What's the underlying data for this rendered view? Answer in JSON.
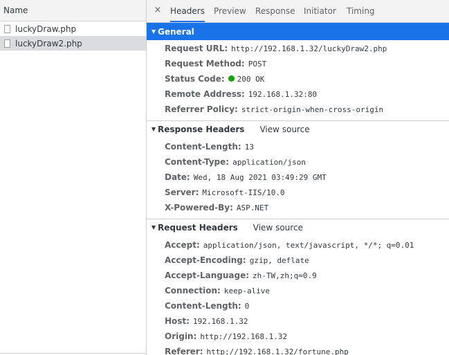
{
  "request_list": {
    "header": "Name",
    "items": [
      {
        "name": "luckyDraw.php",
        "selected": false
      },
      {
        "name": "luckyDraw2.php",
        "selected": true
      }
    ]
  },
  "tabs": {
    "close_glyph": "×",
    "items": [
      "Headers",
      "Preview",
      "Response",
      "Initiator",
      "Timing"
    ],
    "active": "Headers"
  },
  "general": {
    "title": "General",
    "rows": [
      {
        "name": "Request URL:",
        "value": "http://192.168.1.32/luckyDraw2.php"
      },
      {
        "name": "Request Method:",
        "value": "POST"
      },
      {
        "name": "Status Code:",
        "value": "200 OK",
        "status_color": "#0ca40c"
      },
      {
        "name": "Remote Address:",
        "value": "192.168.1.32:80"
      },
      {
        "name": "Referrer Policy:",
        "value": "strict-origin-when-cross-origin"
      }
    ]
  },
  "response_headers": {
    "title": "Response Headers",
    "view_source": "View source",
    "rows": [
      {
        "name": "Content-Length:",
        "value": "13"
      },
      {
        "name": "Content-Type:",
        "value": "application/json"
      },
      {
        "name": "Date:",
        "value": "Wed, 18 Aug 2021 03:49:29 GMT"
      },
      {
        "name": "Server:",
        "value": "Microsoft-IIS/10.0"
      },
      {
        "name": "X-Powered-By:",
        "value": "ASP.NET"
      }
    ]
  },
  "request_headers": {
    "title": "Request Headers",
    "view_source": "View source",
    "rows": [
      {
        "name": "Accept:",
        "value": "application/json, text/javascript, */*; q=0.01"
      },
      {
        "name": "Accept-Encoding:",
        "value": "gzip, deflate"
      },
      {
        "name": "Accept-Language:",
        "value": "zh-TW,zh;q=0.9"
      },
      {
        "name": "Connection:",
        "value": "keep-alive"
      },
      {
        "name": "Content-Length:",
        "value": "0"
      },
      {
        "name": "Host:",
        "value": "192.168.1.32"
      },
      {
        "name": "Origin:",
        "value": "http://192.168.1.32"
      },
      {
        "name": "Referer:",
        "value": "http://192.168.1.32/fortune.php"
      }
    ]
  },
  "colors": {
    "accent": "#1a73e8",
    "selected_row": "#dadce0",
    "status_ok": "#0ca40c"
  }
}
